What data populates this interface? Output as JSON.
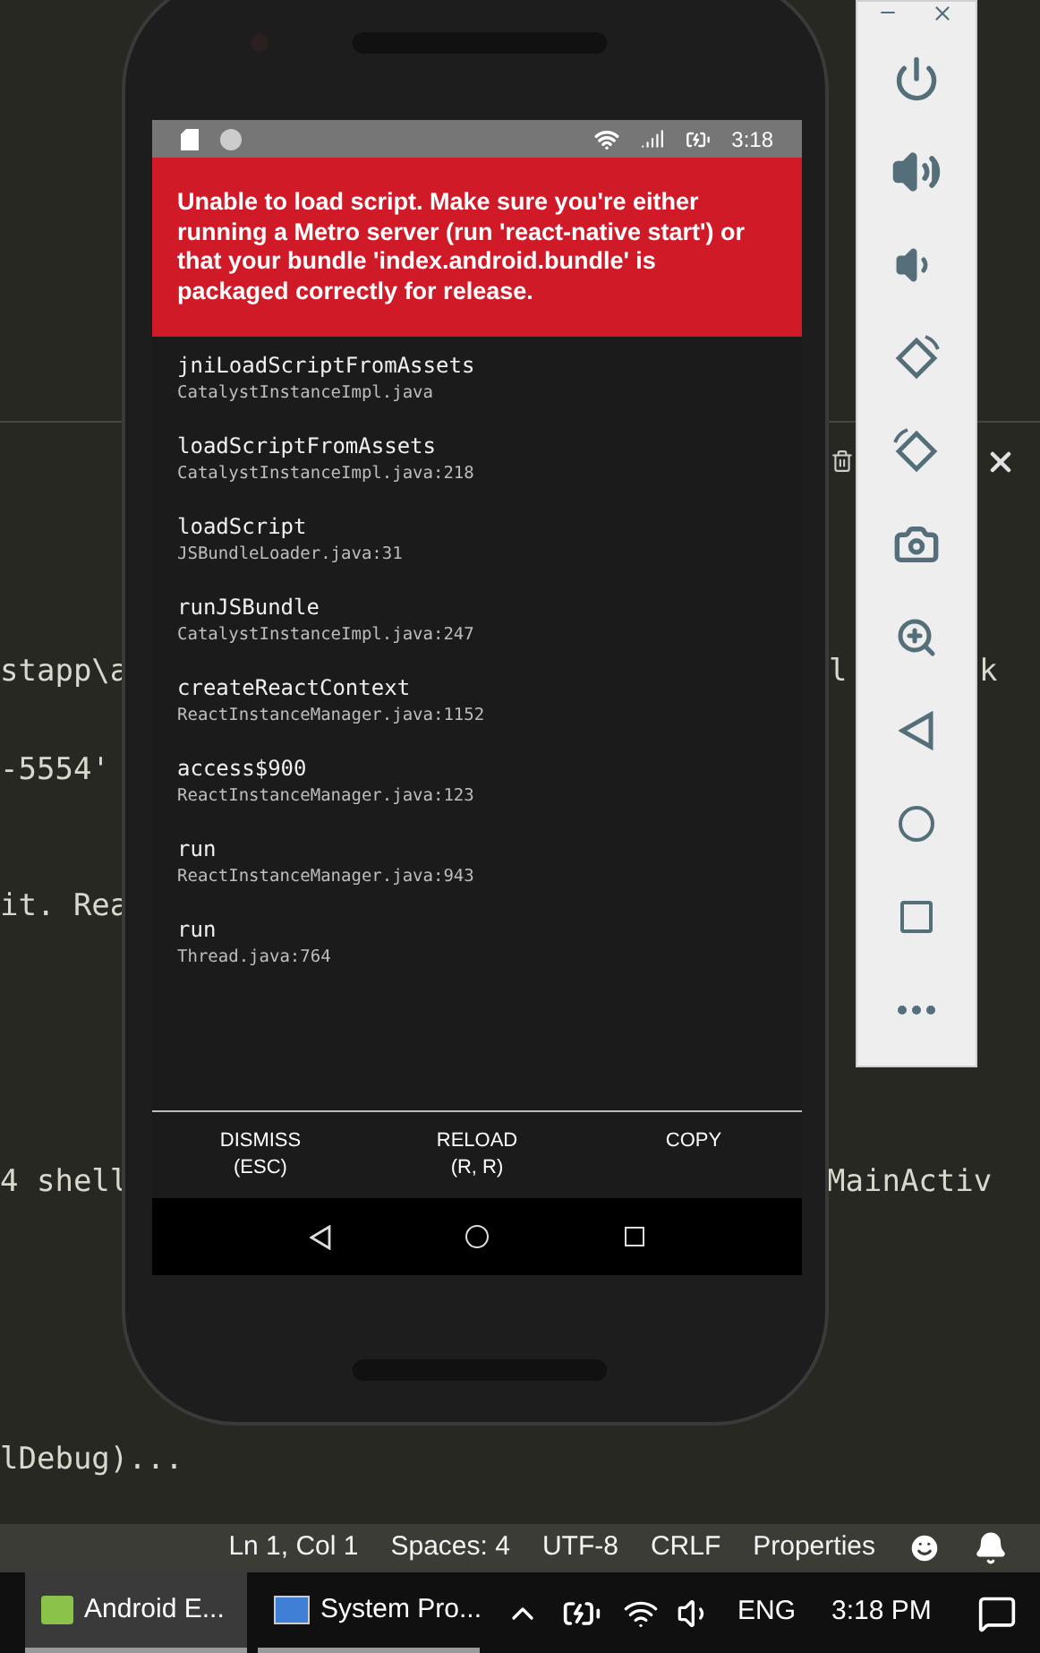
{
  "editor": {
    "rows": [
      {
        "left": "stapp\\a",
        "right": [
          "l",
          "k"
        ]
      },
      {
        "left": "-5554'",
        "right": []
      },
      {
        "left": "it. Rea",
        "right": []
      },
      {
        "left": "4 shell",
        "right": [
          "MainActiv"
        ]
      },
      {
        "left": "lDebug)...",
        "right": []
      }
    ]
  },
  "emulator": {
    "status_bar": {
      "time": "3:18"
    },
    "error": {
      "message": "Unable to load script. Make sure you're either running a Metro server (run 'react-native start') or that your bundle 'index.android.bundle' is packaged correctly for release."
    },
    "stack": [
      {
        "method": "jniLoadScriptFromAssets",
        "location": "CatalystInstanceImpl.java"
      },
      {
        "method": "loadScriptFromAssets",
        "location": "CatalystInstanceImpl.java:218"
      },
      {
        "method": "loadScript",
        "location": "JSBundleLoader.java:31"
      },
      {
        "method": "runJSBundle",
        "location": "CatalystInstanceImpl.java:247"
      },
      {
        "method": "createReactContext",
        "location": "ReactInstanceManager.java:1152"
      },
      {
        "method": "access$900",
        "location": "ReactInstanceManager.java:123"
      },
      {
        "method": "run",
        "location": "ReactInstanceManager.java:943"
      },
      {
        "method": "run",
        "location": "Thread.java:764"
      }
    ],
    "buttons": [
      {
        "label": "DISMISS",
        "hint": "(ESC)"
      },
      {
        "label": "RELOAD",
        "hint": "(R, R)"
      },
      {
        "label": "COPY"
      }
    ]
  },
  "status_bar": {
    "items": [
      "Ln 1, Col 1",
      "Spaces: 4",
      "UTF-8",
      "CRLF",
      "Properties"
    ]
  },
  "taskbar": {
    "apps": [
      {
        "label": "Android E...",
        "selected": true
      },
      {
        "label": "System Pro...",
        "selected": false
      }
    ],
    "language": "ENG",
    "clock": "3:18 PM"
  }
}
